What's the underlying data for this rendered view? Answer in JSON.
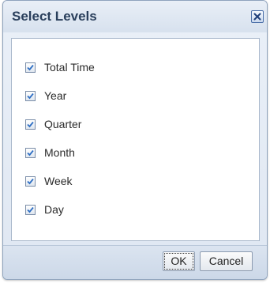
{
  "dialog": {
    "title": "Select Levels",
    "levels": [
      {
        "label": "Total Time",
        "checked": true
      },
      {
        "label": "Year",
        "checked": true
      },
      {
        "label": "Quarter",
        "checked": true
      },
      {
        "label": "Month",
        "checked": true
      },
      {
        "label": "Week",
        "checked": true
      },
      {
        "label": "Day",
        "checked": true
      }
    ],
    "ok_label": "OK",
    "cancel_label": "Cancel"
  },
  "icons": {
    "close": "close-icon",
    "checkbox": "checkmark-icon"
  },
  "colors": {
    "title_text": "#2a3f5c",
    "close_button_border": "#4b6fa8",
    "checkmark": "#2f6fc4",
    "dialog_background": "#dfe7f2"
  }
}
